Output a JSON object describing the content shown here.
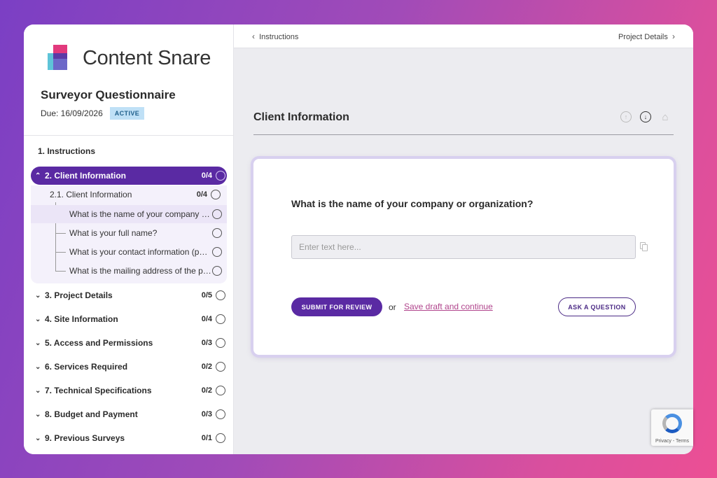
{
  "brand": {
    "name": "Content Snare"
  },
  "survey": {
    "title": "Surveyor Questionnaire",
    "due": "Due: 16/09/2026",
    "status": "ACTIVE"
  },
  "sidebar": {
    "instructions": "1. Instructions",
    "active_section": {
      "label": "2. Client Information",
      "count": "0/4"
    },
    "subsection": {
      "label": "2.1. Client Information",
      "count": "0/4"
    },
    "questions": [
      "What is the name of your company or organization?",
      "What is your full name?",
      "What is your contact information (phone and email)?",
      "What is the mailing address of the property?"
    ],
    "sections": [
      {
        "label": "3. Project Details",
        "count": "0/5"
      },
      {
        "label": "4. Site Information",
        "count": "0/4"
      },
      {
        "label": "5. Access and Permissions",
        "count": "0/3"
      },
      {
        "label": "6. Services Required",
        "count": "0/2"
      },
      {
        "label": "7. Technical Specifications",
        "count": "0/2"
      },
      {
        "label": "8. Budget and Payment",
        "count": "0/3"
      },
      {
        "label": "9. Previous Surveys",
        "count": "0/1"
      }
    ]
  },
  "topbar": {
    "prev": "Instructions",
    "next": "Project Details"
  },
  "main": {
    "section_title": "Client Information",
    "question": "What is the name of your company or organization?",
    "input_placeholder": "Enter text here...",
    "submit_label": "SUBMIT FOR REVIEW",
    "or_label": "or",
    "save_label": "Save draft and continue",
    "ask_label": "ASK A QUESTION"
  },
  "recaptcha": {
    "text": "Privacy - Terms"
  },
  "colors": {
    "accent": "#5a2aa3",
    "link": "#b0448c",
    "badge_bg": "#bfe0f6"
  }
}
